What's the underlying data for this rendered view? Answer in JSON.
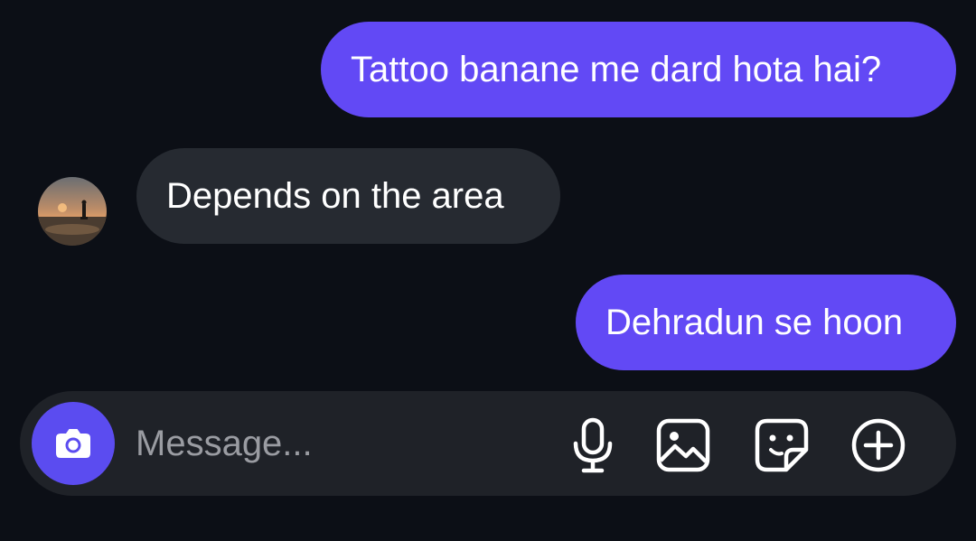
{
  "conversation": {
    "messages": [
      {
        "direction": "sent",
        "text": "Tattoo banane me dard hota hai?"
      },
      {
        "direction": "received",
        "text": "Depends on the area"
      },
      {
        "direction": "sent",
        "text": "Dehradun se hoon"
      }
    ]
  },
  "composer": {
    "placeholder": "Message...",
    "value": "",
    "icons": {
      "camera": "camera-icon",
      "mic": "microphone-icon",
      "gallery": "image-gallery-icon",
      "sticker": "sticker-icon",
      "add": "plus-circle-icon"
    }
  },
  "colors": {
    "background": "#0c0f16",
    "sent_bubble": "#6249f5",
    "received_bubble": "#262a31",
    "composer_bg": "#1f2228",
    "camera_button": "#5b4cf0",
    "placeholder": "#9a9ca2"
  }
}
